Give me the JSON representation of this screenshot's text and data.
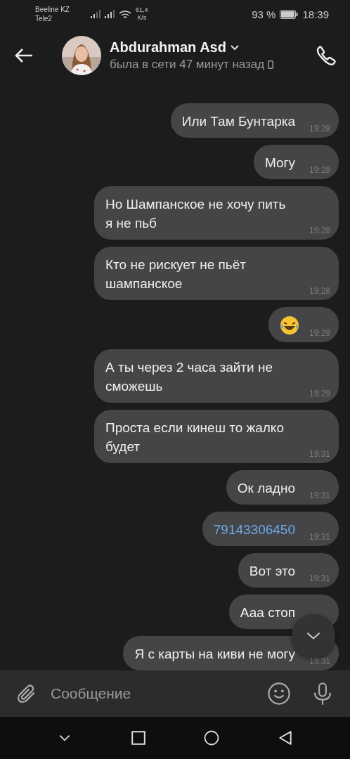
{
  "status_bar": {
    "carrier_1": "Beeline KZ",
    "carrier_2": "Tele2",
    "speed_value": "61,4",
    "speed_unit": "K/s",
    "battery": "93 %",
    "time": "18:39"
  },
  "header": {
    "name": "Abdurahman Asd",
    "status": "была в сети 47 минут назад"
  },
  "messages": [
    {
      "kind": "text",
      "text": "Или Там Бунтарка",
      "time": "19:28"
    },
    {
      "kind": "text",
      "text": "Могу",
      "time": "19:28"
    },
    {
      "kind": "text",
      "text": "Но Шампанское не хочу пить я не пьб",
      "time": "19:28"
    },
    {
      "kind": "text",
      "text": "Кто не рискует не пьёт шампанское",
      "time": "19:28"
    },
    {
      "kind": "emoji",
      "time": "19:29"
    },
    {
      "kind": "text",
      "text": "А ты через 2 часа зайти не сможешь",
      "time": "19:29"
    },
    {
      "kind": "text",
      "text": "Проста если кинеш то жалко будет",
      "time": "19:31"
    },
    {
      "kind": "text",
      "text": "Ок ладно",
      "time": "19:31"
    },
    {
      "kind": "link",
      "text": "79143306450",
      "time": "19:31"
    },
    {
      "kind": "text",
      "text": "Вот это",
      "time": "19:31"
    },
    {
      "kind": "text",
      "text": "Ааа стоп"
    },
    {
      "kind": "text",
      "text": "Я с карты на киви не могу",
      "time": "19:31"
    }
  ],
  "composer": {
    "placeholder": "Сообщение"
  }
}
